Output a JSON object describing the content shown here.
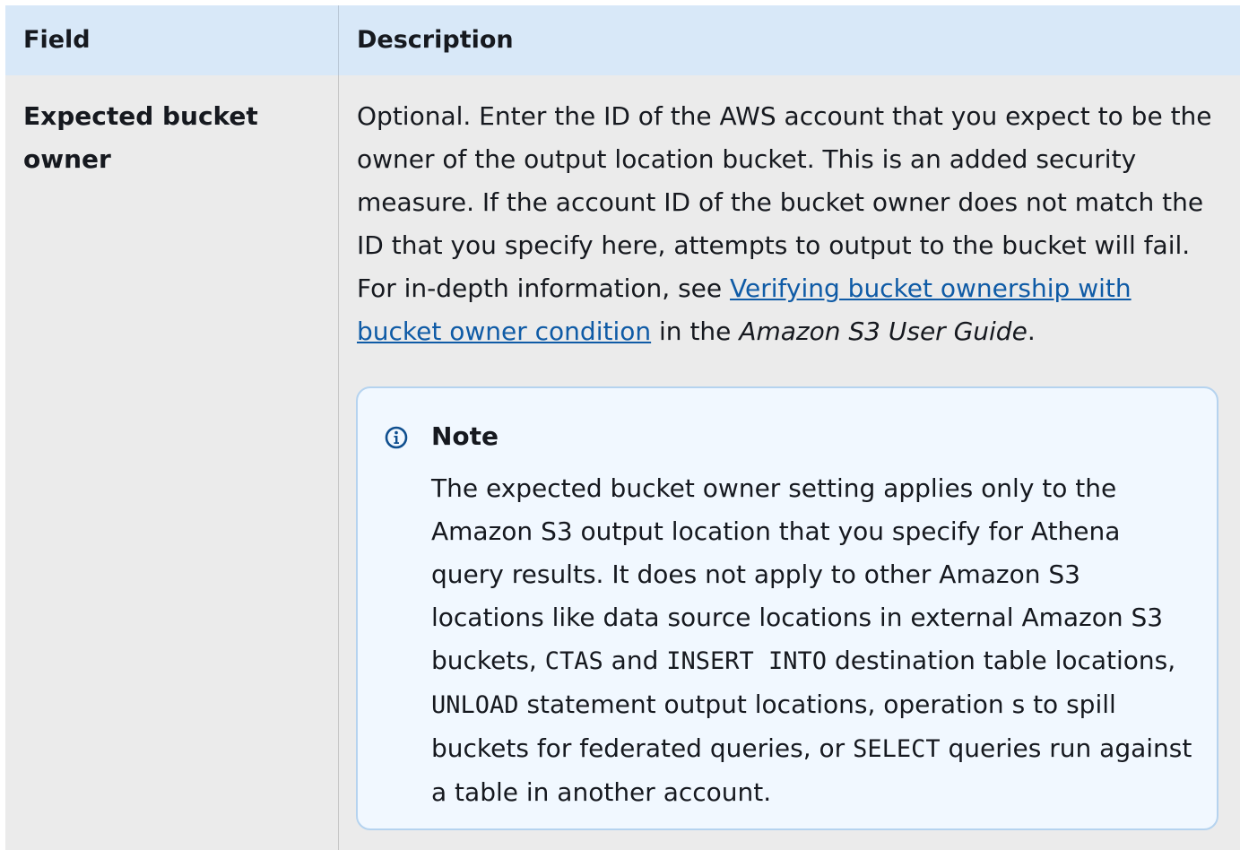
{
  "table": {
    "headers": {
      "field": "Field",
      "description": "Description"
    },
    "row": {
      "field": "Expected bucket owner",
      "description": {
        "before_link": "Optional. Enter the ID of the AWS account that you expect to be the owner of the output location bucket. This is an added security measure. If the account ID of the bucket owner does not match the ID that you specify here, attempts to output to the bucket will fail. For in-depth information, see ",
        "link_text": "Verifying bucket ownership with bucket owner condition",
        "middle": " in the ",
        "guide_title": "Amazon S3 User Guide",
        "end": "."
      }
    }
  },
  "note": {
    "icon": "info-icon",
    "title": "Note",
    "text": {
      "p1": "The expected bucket owner setting applies only to the Amazon S3 output location that you specify for Athena query results. It does not apply to other Amazon S3 locations like data source locations in external Amazon S3 buckets, ",
      "code_ctas": "CTAS",
      "p2": " and ",
      "code_insert": "INSERT INTO",
      "p3": " destination table locations, ",
      "code_unload": "UNLOAD",
      "p4": " statement output locations, operation s to spill buckets for federated queries, or ",
      "code_select": "SELECT",
      "p5": " queries run against a table in another account."
    }
  },
  "colors": {
    "header_bg": "#d8e8f8",
    "row_bg": "#ebebeb",
    "note_bg": "#f1f8ff",
    "note_border": "#b5d3ef",
    "link": "#0f5ba6",
    "icon": "#0f4f8f"
  }
}
